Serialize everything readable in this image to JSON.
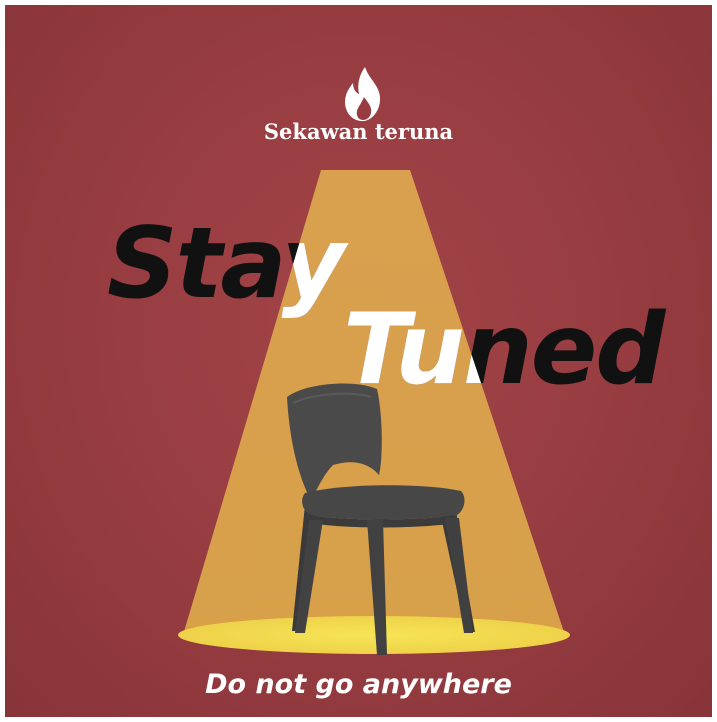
{
  "brand": {
    "name": "Sekawan teruna",
    "logo_icon": "flame-icon"
  },
  "headline": {
    "line1": "Stay",
    "line2": "Tuned"
  },
  "tagline": "Do not go anywhere",
  "illustration": {
    "subject": "chair-icon",
    "light": "spotlight-beam"
  },
  "colors": {
    "background": "#963c41",
    "spotlight": "#d9a04f",
    "spot_floor": "#f4e04d",
    "headline_dark": "#111111",
    "headline_light": "#ffffff",
    "chair": "#454545"
  }
}
